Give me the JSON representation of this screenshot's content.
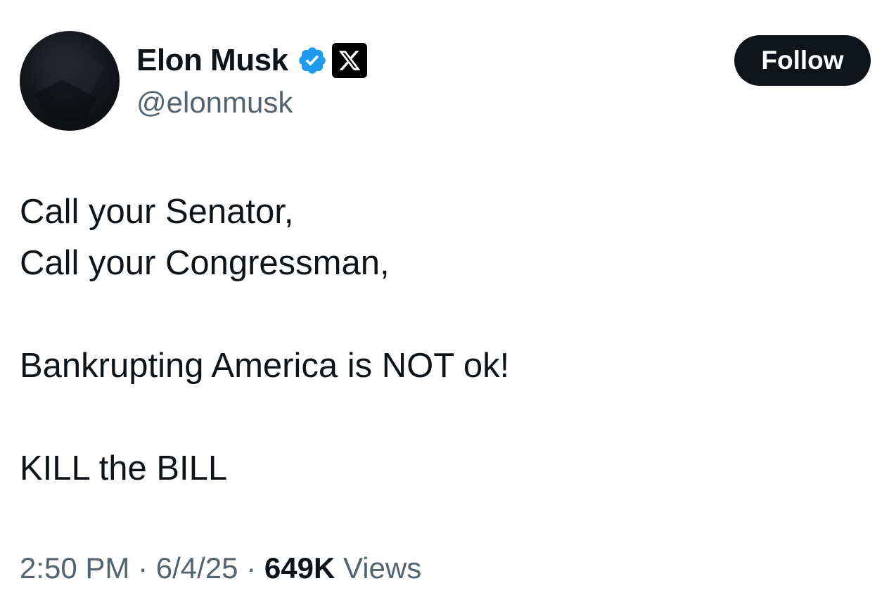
{
  "author": {
    "display_name": "Elon Musk",
    "handle": "@elonmusk",
    "verified": true,
    "verified_color": "#1d9bf0",
    "affiliate_badge_icon": "x-logo-icon"
  },
  "follow_button": {
    "label": "Follow"
  },
  "tweet": {
    "lines": [
      "Call your Senator,",
      "Call your Congressman,",
      "",
      "Bankrupting America is NOT ok!",
      "",
      "KILL the BILL"
    ]
  },
  "meta": {
    "time": "2:50 PM",
    "separator": "·",
    "date": "6/4/25",
    "views_count": "649K",
    "views_label": "Views"
  }
}
